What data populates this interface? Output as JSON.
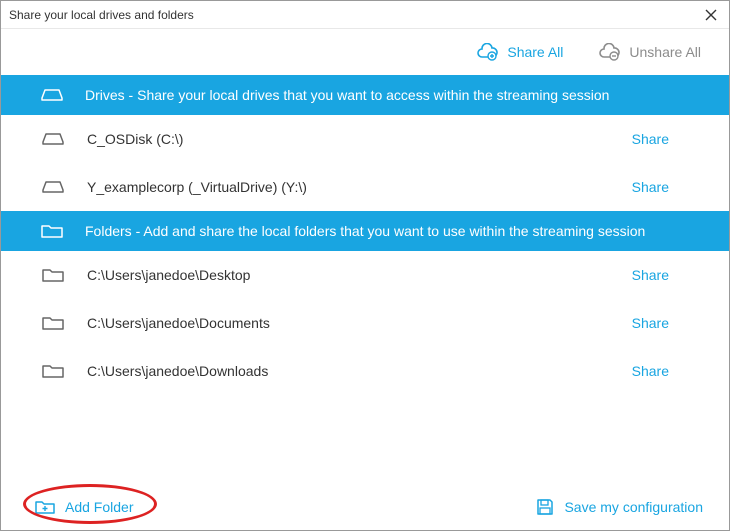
{
  "window": {
    "title": "Share your local drives and folders"
  },
  "toolbar": {
    "share_all": "Share All",
    "unshare_all": "Unshare All"
  },
  "sections": {
    "drives_header": "Drives - Share your local drives that you want to access within the streaming session",
    "folders_header": "Folders - Add and share the local folders that you want to use within the streaming session"
  },
  "drives": [
    {
      "label": "C_OSDisk (C:\\)",
      "action": "Share"
    },
    {
      "label": "Y_examplecorp (_VirtualDrive) (Y:\\)",
      "action": "Share"
    }
  ],
  "folders": [
    {
      "label": "C:\\Users\\janedoe\\Desktop",
      "action": "Share"
    },
    {
      "label": "C:\\Users\\janedoe\\Documents",
      "action": "Share"
    },
    {
      "label": "C:\\Users\\janedoe\\Downloads",
      "action": "Share"
    }
  ],
  "footer": {
    "add_folder": "Add Folder",
    "save_config": "Save my configuration"
  }
}
